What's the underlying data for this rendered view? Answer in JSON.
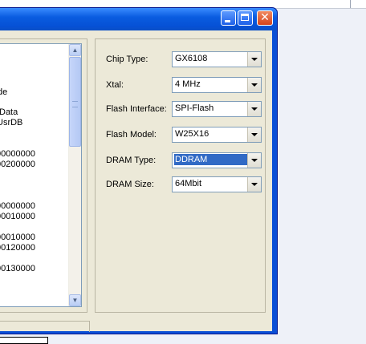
{
  "window": {
    "buttons": {
      "minimize": "minimize",
      "maximize": "maximize",
      "close": "close"
    }
  },
  "list": {
    "lines": [
      "de",
      "Data",
      "UsrDB",
      "00000000",
      "00200000",
      "00000000",
      "00010000",
      "00010000",
      "00120000",
      "00130000"
    ]
  },
  "settings": {
    "chip_type": {
      "label": "Chip Type:",
      "value": "GX6108"
    },
    "xtal": {
      "label": "Xtal:",
      "value": "4 MHz"
    },
    "flash_interface": {
      "label": "Flash Interface:",
      "value": "SPI-Flash"
    },
    "flash_model": {
      "label": "Flash Model:",
      "value": "W25X16"
    },
    "dram_type": {
      "label": "DRAM Type:",
      "value": "DDRAM"
    },
    "dram_size": {
      "label": "DRAM Size:",
      "value": "64Mbit"
    }
  },
  "colors": {
    "titlebar": "#0a5ce0",
    "dialog_bg": "#ece9d8",
    "selection": "#316ac5",
    "close_button": "#d5431c"
  },
  "icons": [
    "minimize-icon",
    "maximize-icon",
    "close-icon",
    "scroll-up-icon",
    "scroll-down-icon",
    "dropdown-arrow-icon"
  ]
}
